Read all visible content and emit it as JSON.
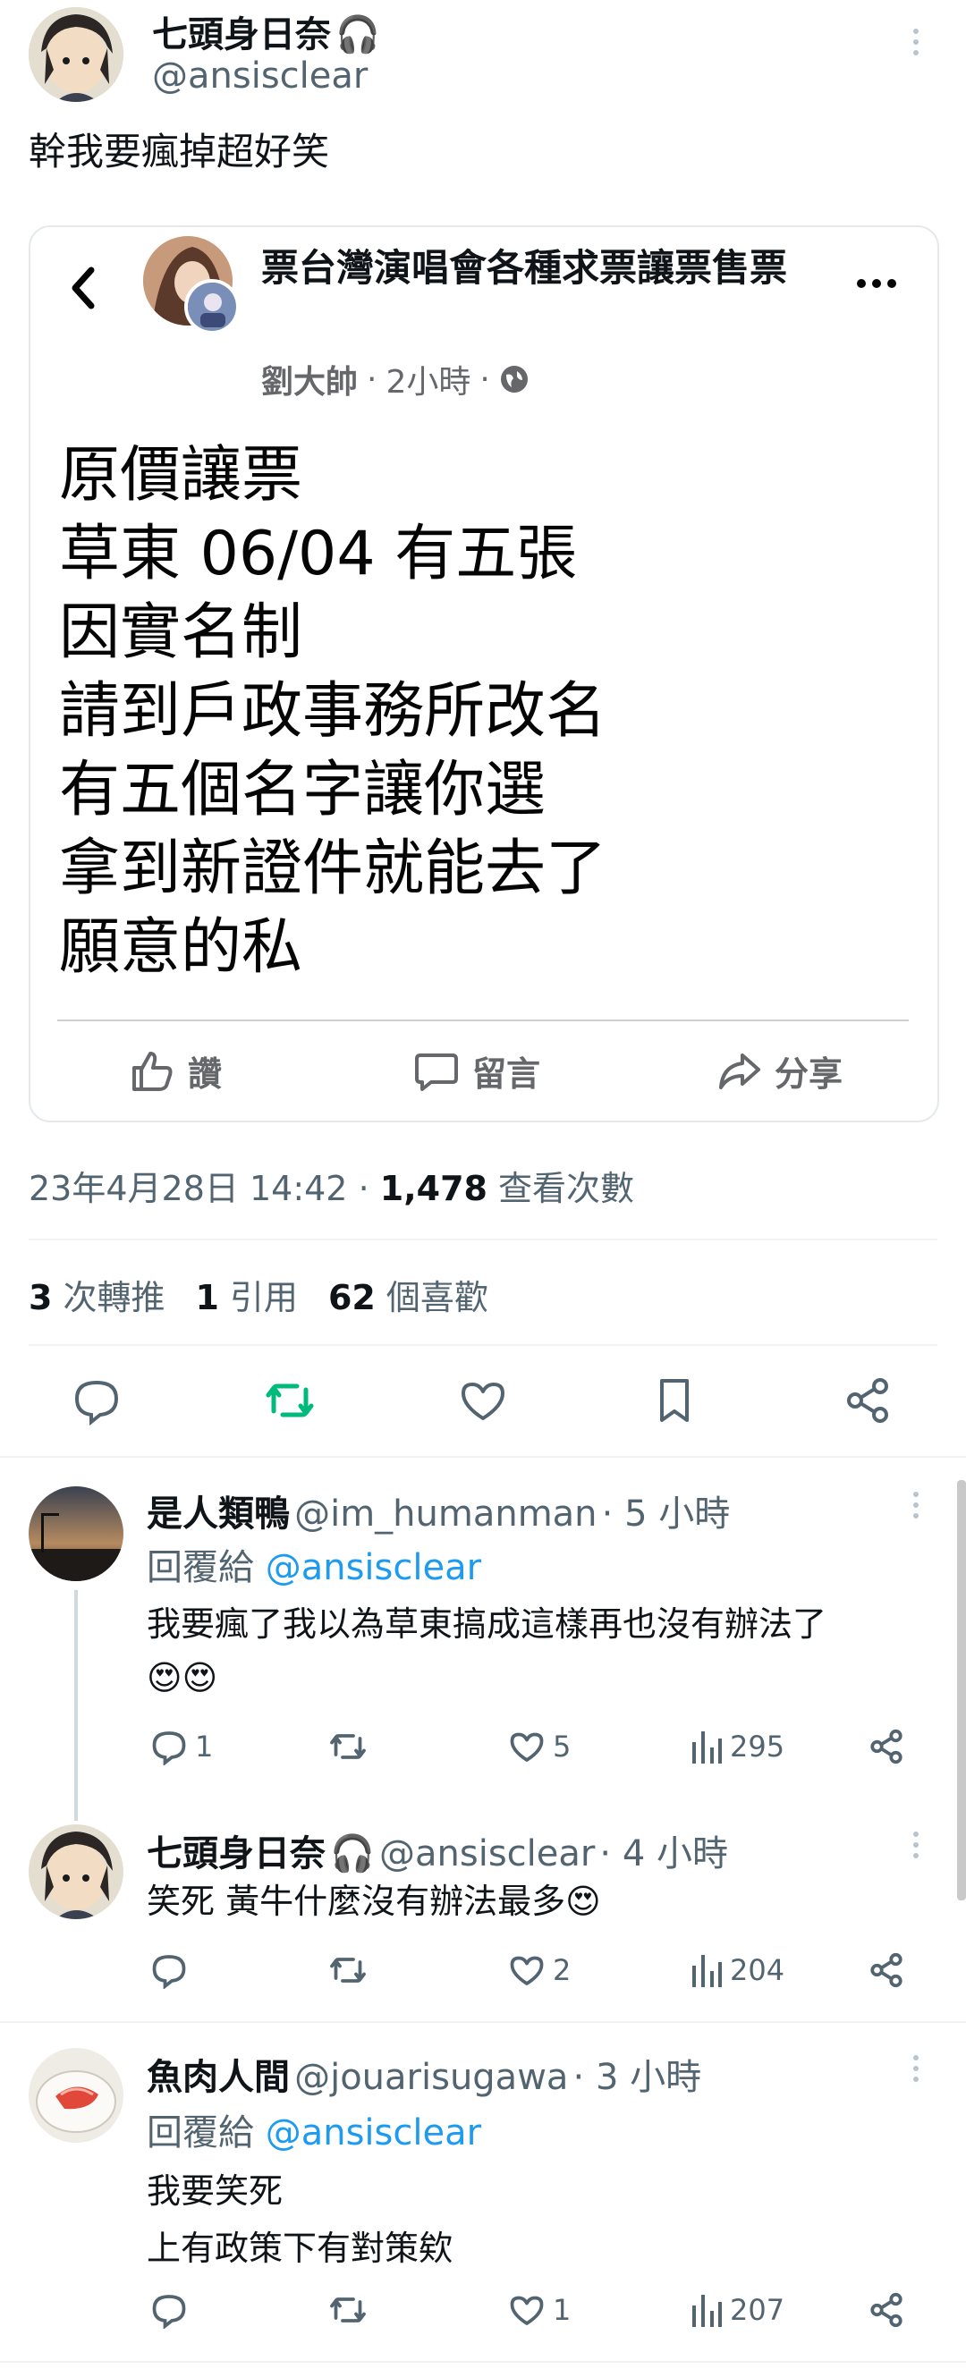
{
  "main_tweet": {
    "author_name": "七頭身日奈",
    "author_emoji": "🎧",
    "handle": "@ansisclear",
    "text": "幹我要瘋掉超好笑"
  },
  "embedded_post": {
    "title": "票台灣演唱會各種求票讓票售票",
    "author": "劉大帥",
    "time": "2小時",
    "body_lines": [
      "原價讓票",
      "草東 06/04 有五張",
      "因實名制",
      "請到戶政事務所改名",
      "有五個名字讓你選",
      "拿到新證件就能去了",
      "願意的私"
    ],
    "actions": {
      "like": "讚",
      "comment": "留言",
      "share": "分享"
    }
  },
  "meta": {
    "date": "23年4月28日 14:42",
    "views_count": "1,478",
    "views_label": "查看次數"
  },
  "stats": {
    "retweets": "3",
    "retweets_label": "次轉推",
    "quotes": "1",
    "quotes_label": "引用",
    "likes": "62",
    "likes_label": "個喜歡"
  },
  "colors": {
    "retweet_green": "#00ba7c",
    "link_blue": "#1d9bf0",
    "secondary": "#536471"
  },
  "replies": [
    {
      "name": "是人類鴨",
      "handle": "@im_humanman",
      "time": "5 小時",
      "replying_to_label": "回覆給",
      "replying_to": "@ansisclear",
      "text": "我要瘋了我以為草東搞成這樣再也沒有辦法了",
      "emoji": "😍😍",
      "reply_count": "1",
      "retweet_count": "",
      "like_count": "5",
      "view_count": "295"
    },
    {
      "name": "七頭身日奈",
      "name_emoji": "🎧",
      "handle": "@ansisclear",
      "time": "4 小時",
      "text": "笑死 黃牛什麼沒有辦法最多😍",
      "reply_count": "",
      "retweet_count": "",
      "like_count": "2",
      "view_count": "204"
    },
    {
      "name": "魚肉人間",
      "handle": "@jouarisugawa",
      "time": "3 小時",
      "replying_to_label": "回覆給",
      "replying_to": "@ansisclear",
      "text_line1": "我要笑死",
      "text_line2": "上有政策下有對策欸",
      "reply_count": "",
      "retweet_count": "",
      "like_count": "1",
      "view_count": "207"
    }
  ]
}
